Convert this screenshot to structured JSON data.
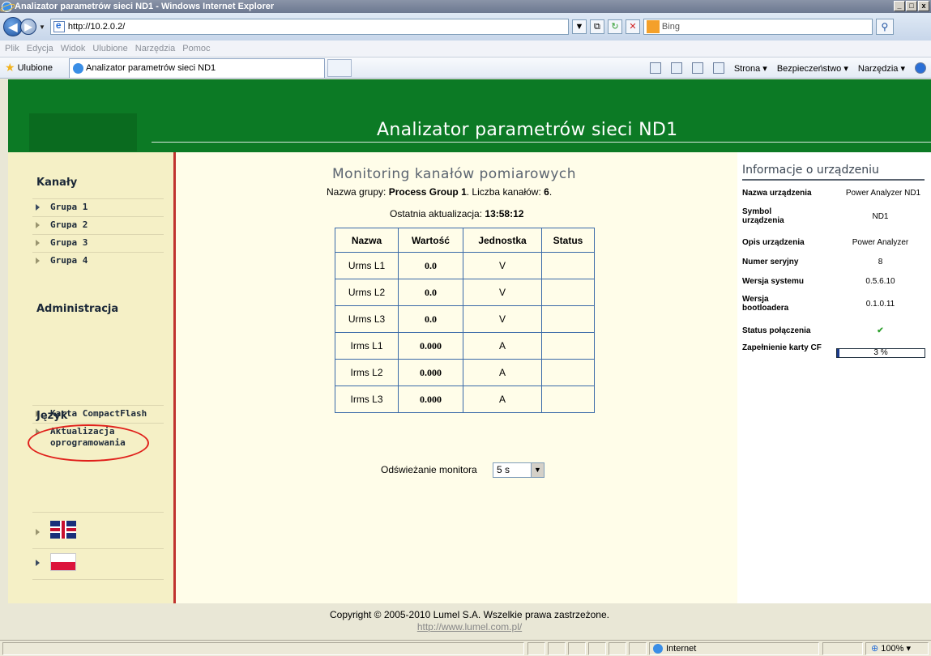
{
  "window": {
    "title": "Analizator parametrów sieci ND1 - Windows Internet Explorer",
    "buttons": [
      "_",
      "□",
      "x"
    ]
  },
  "address": {
    "url": "http://10.2.0.2/",
    "search_placeholder": "Bing"
  },
  "menu": [
    "Plik",
    "Edycja",
    "Widok",
    "Ulubione",
    "Narzędzia",
    "Pomoc"
  ],
  "favorites": {
    "label": "Ulubione",
    "tab": "Analizator parametrów sieci ND1",
    "commands": [
      "Strona ▾",
      "Bezpieczeństwo ▾",
      "Narzędzia ▾"
    ]
  },
  "header": {
    "title": "Analizator parametrów sieci ND1"
  },
  "sidebar": {
    "channels_heading": "Kanały",
    "groups": [
      "Grupa 1",
      "Grupa 2",
      "Grupa 3",
      "Grupa 4"
    ],
    "admin_heading": "Administracja",
    "admin_items": [
      "Karta CompactFlash",
      "Aktualizacja oprogramowania"
    ],
    "lang_heading": "Język"
  },
  "main": {
    "heading": "Monitoring kanałów pomiarowych",
    "group_prefix": "Nazwa grupy: ",
    "group_name": "Process Group 1",
    "count_prefix": ". Liczba kanałów: ",
    "count": "6",
    "count_suffix": ".",
    "update_prefix": "Ostatnia aktualizacja: ",
    "update_time": "13:58:12",
    "columns": [
      "Nazwa",
      "Wartość",
      "Jednostka",
      "Status"
    ],
    "rows": [
      [
        "Urms L1",
        "0.0",
        "V",
        ""
      ],
      [
        "Urms L2",
        "0.0",
        "V",
        ""
      ],
      [
        "Urms L3",
        "0.0",
        "V",
        ""
      ],
      [
        "Irms L1",
        "0.000",
        "A",
        ""
      ],
      [
        "Irms L2",
        "0.000",
        "A",
        ""
      ],
      [
        "Irms L3",
        "0.000",
        "A",
        ""
      ]
    ],
    "refresh_label": "Odświeżanie monitora",
    "refresh_value": "5 s"
  },
  "info": {
    "heading": "Informacje o urządzeniu",
    "rows": [
      {
        "label": "Nazwa urządzenia",
        "value": "Power Analyzer ND1"
      },
      {
        "label": "Symbol urządzenia",
        "value": "ND1"
      },
      {
        "label": "Opis urządzenia",
        "value": "Power Analyzer"
      },
      {
        "label": "Numer seryjny",
        "value": "8"
      },
      {
        "label": "Wersja systemu",
        "value": "0.5.6.10"
      },
      {
        "label": "Wersja bootloadera",
        "value": "0.1.0.11"
      },
      {
        "label": "Status połączenia",
        "value": "✔"
      },
      {
        "label": "Zapełnienie karty CF",
        "value": "3 %"
      }
    ],
    "cf_fill_fraction": 0.03
  },
  "footer": {
    "copyright": "Copyright © 2005-2010 Lumel S.A. Wszelkie prawa zastrzeżone.",
    "url": "http://www.lumel.com.pl/"
  },
  "status": {
    "zone": "Internet",
    "zoom": "100%"
  },
  "colors": {
    "header_green": "#0c7a25",
    "sidebar_border": "#c0332f",
    "highlight_ellipse": "#e0201b"
  }
}
